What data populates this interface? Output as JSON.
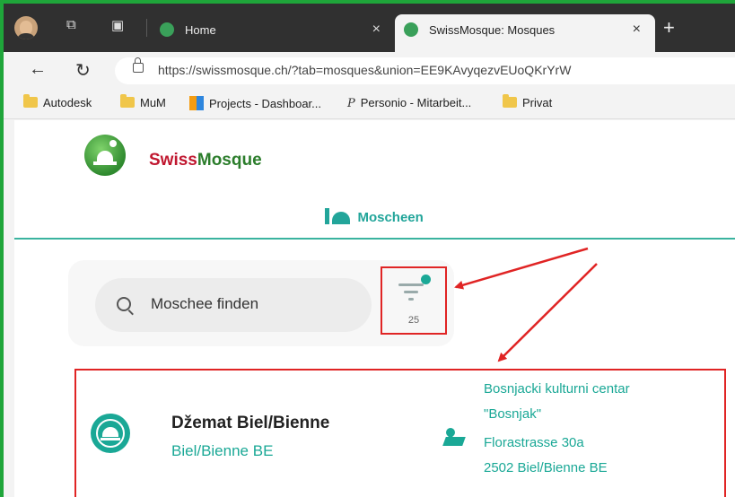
{
  "browser": {
    "tabs": [
      {
        "title": "Home",
        "close": "×"
      },
      {
        "title": "SwissMosque: Mosques",
        "close": "×"
      }
    ],
    "new_tab": "+",
    "back": "←",
    "reload": "↻",
    "url": "https://swissmosque.ch/?tab=mosques&union=EE9KAvyqezvEUoQKrYrW",
    "bookmarks": [
      "Autodesk",
      "MuM",
      "Projects - Dashboar...",
      "Personio - Mitarbeit...",
      "Privat"
    ]
  },
  "site": {
    "brand_part1": "Swiss",
    "brand_part2": "Mosque",
    "nav_tab": "Moscheen",
    "search_placeholder": "Moschee finden",
    "filter_count": "25",
    "card": {
      "title": "Džemat Biel/Bienne",
      "city": "Biel/Bienne BE",
      "address": [
        "Bosnjacki kulturni centar",
        "\"Bosnjak\"",
        "Florastrasse 30a",
        "2502 Biel/Bienne BE"
      ]
    }
  },
  "colors": {
    "accent": "#1aa896",
    "brand_red": "#c0172f",
    "brand_green": "#2b7d2b",
    "annotation": "#e02424",
    "frame": "#1fa53a"
  }
}
